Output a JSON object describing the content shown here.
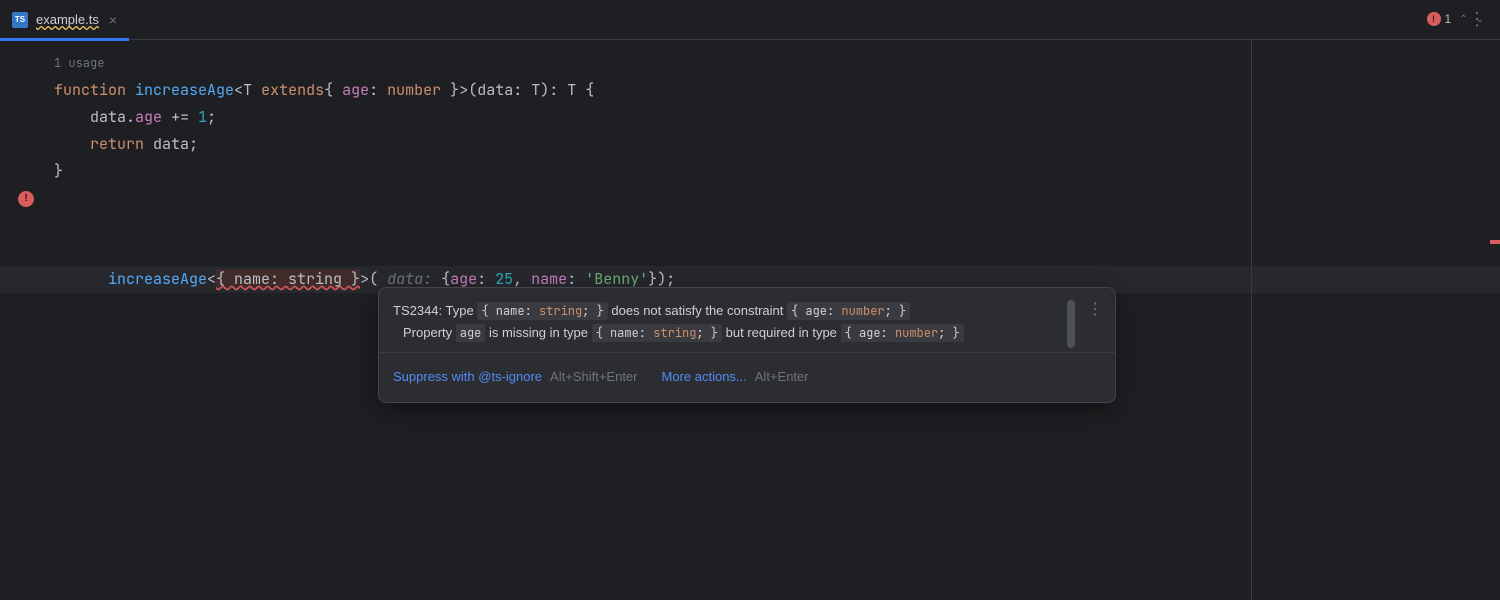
{
  "tab": {
    "name": "example.ts",
    "file_icon": "TS"
  },
  "rail": {
    "error_count": "1"
  },
  "usage": {
    "label": "1 usage"
  },
  "code": {
    "l1": {
      "kw1": "function",
      "fn": "increaseAge",
      "lt": "<",
      "t": "T",
      "kw2": "extends",
      "ob": "{ ",
      "prop": "age",
      "col": ": ",
      "typ": "number",
      "cb": " }",
      "gt": ">(",
      "param": "data",
      "col2": ": ",
      "t2": "T",
      "cp": "): ",
      "t3": "T",
      "ob2": " {"
    },
    "l2": {
      "indent": "    ",
      "obj": "data",
      "dot": ".",
      "prop": "age",
      "op": " += ",
      "num": "1",
      "semi": ";"
    },
    "l3": {
      "indent": "    ",
      "kw": "return",
      "sp": " ",
      "obj": "data",
      "semi": ";"
    },
    "l4": {
      "cb": "}"
    },
    "l6": {
      "fn": "increaseAge",
      "lt": "<",
      "err": "{ name: string }",
      "gt": ">(",
      "paramh": " data: ",
      "ob": "{",
      "prop1": "age",
      "col1": ": ",
      "num": "25",
      "comma": ", ",
      "prop2": "name",
      "col2": ": ",
      "str": "'Benny'",
      "cb": "});"
    }
  },
  "tooltip": {
    "code": "TS2344",
    "msg1a": ": Type ",
    "chip1": {
      "o": "{ ",
      "k": "name",
      "c": ": ",
      "t": "string",
      "e": "; }"
    },
    "msg1b": " does not satisfy the constraint ",
    "chip2": {
      "o": "{ ",
      "k": "age",
      "c": ": ",
      "t": "number",
      "e": "; }"
    },
    "msg2a": "Property ",
    "chip3": "age",
    "msg2b": " is missing in type ",
    "chip4": {
      "o": "{ ",
      "k": "name",
      "c": ": ",
      "t": "string",
      "e": "; }"
    },
    "msg2c": " but required in type ",
    "chip5": {
      "o": "{ ",
      "k": "age",
      "c": ": ",
      "t": "number",
      "e": "; }"
    },
    "suppress": "Suppress with @ts-ignore",
    "suppress_key": "Alt+Shift+Enter",
    "more": "More actions...",
    "more_key": "Alt+Enter"
  }
}
